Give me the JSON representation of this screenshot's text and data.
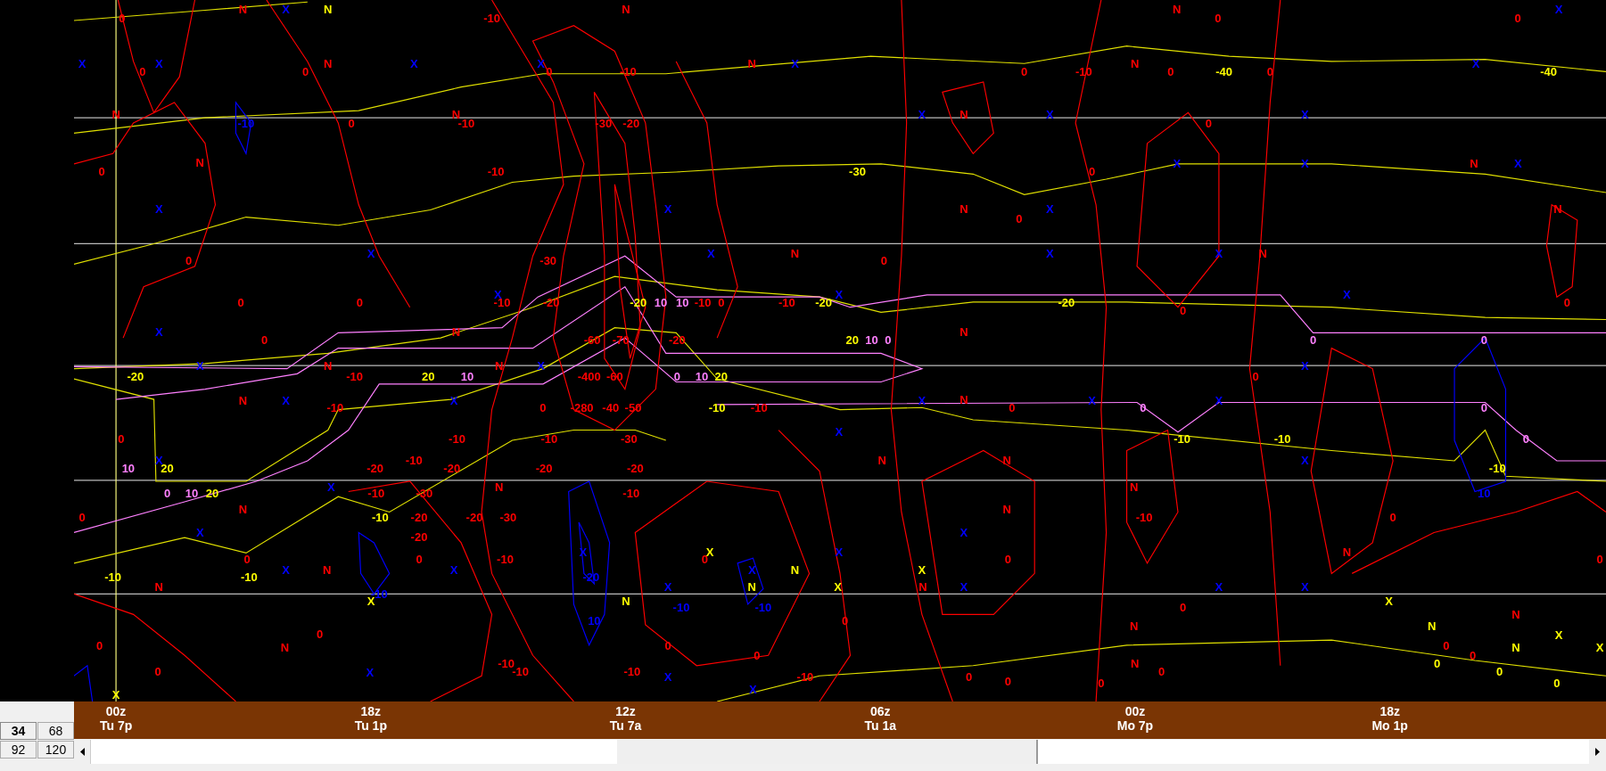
{
  "plot": {
    "labels": [
      {
        "text": "0",
        "color": "#ff0000"
      },
      {
        "text": "N",
        "color": "#ff0000"
      },
      {
        "text": "X",
        "color": "#0000ff"
      },
      {
        "text": "N",
        "color": "#ffff00"
      },
      {
        "text": "-10",
        "color": "#ff0000"
      },
      {
        "text": "N",
        "color": "#ff0000"
      },
      {
        "text": "N",
        "color": "#ff0000"
      },
      {
        "text": "0",
        "color": "#ff0000"
      },
      {
        "text": "0",
        "color": "#ff0000"
      },
      {
        "text": "X",
        "color": "#0000ff"
      },
      {
        "text": "X",
        "color": "#0000ff"
      },
      {
        "text": "0",
        "color": "#ff0000"
      },
      {
        "text": "X",
        "color": "#0000ff"
      },
      {
        "text": "0",
        "color": "#ff0000"
      },
      {
        "text": "N",
        "color": "#ff0000"
      },
      {
        "text": "X",
        "color": "#0000ff"
      },
      {
        "text": "X",
        "color": "#0000ff"
      },
      {
        "text": "0",
        "color": "#ff0000"
      },
      {
        "text": "-10",
        "color": "#ff0000"
      },
      {
        "text": "N",
        "color": "#ff0000"
      },
      {
        "text": "X",
        "color": "#0000ff"
      },
      {
        "text": "0",
        "color": "#ff0000"
      },
      {
        "text": "-10",
        "color": "#ff0000"
      },
      {
        "text": "N",
        "color": "#ff0000"
      },
      {
        "text": "0",
        "color": "#ff0000"
      },
      {
        "text": "-40",
        "color": "#ffff00"
      },
      {
        "text": "0",
        "color": "#ff0000"
      },
      {
        "text": "X",
        "color": "#0000ff"
      },
      {
        "text": "-40",
        "color": "#ffff00"
      },
      {
        "text": "N",
        "color": "#ff0000"
      },
      {
        "text": "-10",
        "color": "#0000ff"
      },
      {
        "text": "0",
        "color": "#ff0000"
      },
      {
        "text": "N",
        "color": "#ff0000"
      },
      {
        "text": "-10",
        "color": "#ff0000"
      },
      {
        "text": "-30",
        "color": "#ff0000"
      },
      {
        "text": "-20",
        "color": "#ff0000"
      },
      {
        "text": "X",
        "color": "#0000ff"
      },
      {
        "text": "N",
        "color": "#ff0000"
      },
      {
        "text": "X",
        "color": "#0000ff"
      },
      {
        "text": "0",
        "color": "#ff0000"
      },
      {
        "text": "X",
        "color": "#0000ff"
      },
      {
        "text": "0",
        "color": "#ff0000"
      },
      {
        "text": "N",
        "color": "#ff0000"
      },
      {
        "text": "-10",
        "color": "#ff0000"
      },
      {
        "text": "-30",
        "color": "#ffff00"
      },
      {
        "text": "0",
        "color": "#ff0000"
      },
      {
        "text": "X",
        "color": "#0000ff"
      },
      {
        "text": "X",
        "color": "#0000ff"
      },
      {
        "text": "N",
        "color": "#ff0000"
      },
      {
        "text": "X",
        "color": "#0000ff"
      },
      {
        "text": "X",
        "color": "#0000ff"
      },
      {
        "text": "X",
        "color": "#0000ff"
      },
      {
        "text": "N",
        "color": "#ff0000"
      },
      {
        "text": "0",
        "color": "#ff0000"
      },
      {
        "text": "X",
        "color": "#0000ff"
      },
      {
        "text": "N",
        "color": "#ff0000"
      },
      {
        "text": "0",
        "color": "#ff0000"
      },
      {
        "text": "X",
        "color": "#0000ff"
      },
      {
        "text": "-30",
        "color": "#ff0000"
      },
      {
        "text": "X",
        "color": "#0000ff"
      },
      {
        "text": "N",
        "color": "#ff0000"
      },
      {
        "text": "0",
        "color": "#ff0000"
      },
      {
        "text": "X",
        "color": "#0000ff"
      },
      {
        "text": "X",
        "color": "#0000ff"
      },
      {
        "text": "N",
        "color": "#ff0000"
      },
      {
        "text": "0",
        "color": "#ff0000"
      },
      {
        "text": "0",
        "color": "#ff0000"
      },
      {
        "text": "X",
        "color": "#0000ff"
      },
      {
        "text": "-10",
        "color": "#ff0000"
      },
      {
        "text": "-20",
        "color": "#ff0000"
      },
      {
        "text": "-20",
        "color": "#ffff00"
      },
      {
        "text": "10",
        "color": "#ff80ff"
      },
      {
        "text": "10",
        "color": "#ff80ff"
      },
      {
        "text": "-10",
        "color": "#ff0000"
      },
      {
        "text": "0",
        "color": "#ff0000"
      },
      {
        "text": "-10",
        "color": "#ff0000"
      },
      {
        "text": "-20",
        "color": "#ffff00"
      },
      {
        "text": "X",
        "color": "#0000ff"
      },
      {
        "text": "-20",
        "color": "#ffff00"
      },
      {
        "text": "0",
        "color": "#ff0000"
      },
      {
        "text": "X",
        "color": "#0000ff"
      },
      {
        "text": "0",
        "color": "#ff0000"
      },
      {
        "text": "X",
        "color": "#0000ff"
      },
      {
        "text": "0",
        "color": "#ff0000"
      },
      {
        "text": "N",
        "color": "#ff0000"
      },
      {
        "text": "-60",
        "color": "#ff0000"
      },
      {
        "text": "-70",
        "color": "#ff0000"
      },
      {
        "text": "-20",
        "color": "#ff0000"
      },
      {
        "text": "20",
        "color": "#ffff00"
      },
      {
        "text": "10",
        "color": "#ff80ff"
      },
      {
        "text": "0",
        "color": "#ff80ff"
      },
      {
        "text": "N",
        "color": "#ff0000"
      },
      {
        "text": "0",
        "color": "#ff80ff"
      },
      {
        "text": "0",
        "color": "#ff80ff"
      },
      {
        "text": "-20",
        "color": "#ffff00"
      },
      {
        "text": "X",
        "color": "#0000ff"
      },
      {
        "text": "N",
        "color": "#ff0000"
      },
      {
        "text": "-10",
        "color": "#ff0000"
      },
      {
        "text": "20",
        "color": "#ffff00"
      },
      {
        "text": "10",
        "color": "#ff80ff"
      },
      {
        "text": "N",
        "color": "#ff0000"
      },
      {
        "text": "X",
        "color": "#0000ff"
      },
      {
        "text": "-400",
        "color": "#ff0000"
      },
      {
        "text": "-60",
        "color": "#ff0000"
      },
      {
        "text": "0",
        "color": "#ff80ff"
      },
      {
        "text": "10",
        "color": "#ff80ff"
      },
      {
        "text": "20",
        "color": "#ffff00"
      },
      {
        "text": "0",
        "color": "#ff0000"
      },
      {
        "text": "X",
        "color": "#0000ff"
      },
      {
        "text": "N",
        "color": "#ff0000"
      },
      {
        "text": "X",
        "color": "#0000ff"
      },
      {
        "text": "-10",
        "color": "#ff0000"
      },
      {
        "text": "X",
        "color": "#0000ff"
      },
      {
        "text": "0",
        "color": "#ff0000"
      },
      {
        "text": "-280",
        "color": "#ff0000"
      },
      {
        "text": "-40",
        "color": "#ff0000"
      },
      {
        "text": "-50",
        "color": "#ff0000"
      },
      {
        "text": "-10",
        "color": "#ffff00"
      },
      {
        "text": "-10",
        "color": "#ff0000"
      },
      {
        "text": "X",
        "color": "#0000ff"
      },
      {
        "text": "N",
        "color": "#ff0000"
      },
      {
        "text": "0",
        "color": "#ff0000"
      },
      {
        "text": "X",
        "color": "#0000ff"
      },
      {
        "text": "0",
        "color": "#ff80ff"
      },
      {
        "text": "X",
        "color": "#0000ff"
      },
      {
        "text": "0",
        "color": "#ff80ff"
      },
      {
        "text": "0",
        "color": "#ff0000"
      },
      {
        "text": "-10",
        "color": "#ff0000"
      },
      {
        "text": "-10",
        "color": "#ff0000"
      },
      {
        "text": "-30",
        "color": "#ff0000"
      },
      {
        "text": "X",
        "color": "#0000ff"
      },
      {
        "text": "-10",
        "color": "#ffff00"
      },
      {
        "text": "-10",
        "color": "#ffff00"
      },
      {
        "text": "0",
        "color": "#ff80ff"
      },
      {
        "text": "10",
        "color": "#ff80ff"
      },
      {
        "text": "X",
        "color": "#0000ff"
      },
      {
        "text": "20",
        "color": "#ffff00"
      },
      {
        "text": "-20",
        "color": "#ff0000"
      },
      {
        "text": "-10",
        "color": "#ff0000"
      },
      {
        "text": "-20",
        "color": "#ff0000"
      },
      {
        "text": "-20",
        "color": "#ff0000"
      },
      {
        "text": "-20",
        "color": "#ff0000"
      },
      {
        "text": "N",
        "color": "#ff0000"
      },
      {
        "text": "N",
        "color": "#ff0000"
      },
      {
        "text": "X",
        "color": "#0000ff"
      },
      {
        "text": "-10",
        "color": "#ffff00"
      },
      {
        "text": "0",
        "color": "#ff80ff"
      },
      {
        "text": "10",
        "color": "#ff80ff"
      },
      {
        "text": "20",
        "color": "#ffff00"
      },
      {
        "text": "X",
        "color": "#0000ff"
      },
      {
        "text": "-10",
        "color": "#ff0000"
      },
      {
        "text": "-30",
        "color": "#ff0000"
      },
      {
        "text": "N",
        "color": "#ff0000"
      },
      {
        "text": "-10",
        "color": "#ff0000"
      },
      {
        "text": "N",
        "color": "#ff0000"
      },
      {
        "text": "10",
        "color": "#0000ff"
      },
      {
        "text": "0",
        "color": "#ff0000"
      },
      {
        "text": "N",
        "color": "#ff0000"
      },
      {
        "text": "-10",
        "color": "#ffff00"
      },
      {
        "text": "-20",
        "color": "#ff0000"
      },
      {
        "text": "-20",
        "color": "#ff0000"
      },
      {
        "text": "-30",
        "color": "#ff0000"
      },
      {
        "text": "N",
        "color": "#ff0000"
      },
      {
        "text": "-10",
        "color": "#ff0000"
      },
      {
        "text": "0",
        "color": "#ff0000"
      },
      {
        "text": "X",
        "color": "#0000ff"
      },
      {
        "text": "-20",
        "color": "#ff0000"
      },
      {
        "text": "X",
        "color": "#0000ff"
      },
      {
        "text": "0",
        "color": "#ff0000"
      },
      {
        "text": "0",
        "color": "#ff0000"
      },
      {
        "text": "-10",
        "color": "#ff0000"
      },
      {
        "text": "X",
        "color": "#0000ff"
      },
      {
        "text": "0",
        "color": "#ff0000"
      },
      {
        "text": "X",
        "color": "#ffff00"
      },
      {
        "text": "X",
        "color": "#0000ff"
      },
      {
        "text": "0",
        "color": "#ff0000"
      },
      {
        "text": "N",
        "color": "#ff0000"
      },
      {
        "text": "0",
        "color": "#ff0000"
      },
      {
        "text": "-10",
        "color": "#ffff00"
      },
      {
        "text": "-10",
        "color": "#ffff00"
      },
      {
        "text": "X",
        "color": "#0000ff"
      },
      {
        "text": "N",
        "color": "#ff0000"
      },
      {
        "text": "X",
        "color": "#0000ff"
      },
      {
        "text": "-20",
        "color": "#0000ff"
      },
      {
        "text": "X",
        "color": "#0000ff"
      },
      {
        "text": "N",
        "color": "#ffff00"
      },
      {
        "text": "X",
        "color": "#ffff00"
      },
      {
        "text": "N",
        "color": "#ff0000"
      },
      {
        "text": "-10",
        "color": "#0000ff"
      },
      {
        "text": "X",
        "color": "#0000ff"
      },
      {
        "text": "N",
        "color": "#ffff00"
      },
      {
        "text": "X",
        "color": "#ffff00"
      },
      {
        "text": "N",
        "color": "#ff0000"
      },
      {
        "text": "X",
        "color": "#0000ff"
      },
      {
        "text": "X",
        "color": "#0000ff"
      },
      {
        "text": "X",
        "color": "#0000ff"
      },
      {
        "text": "X",
        "color": "#ffff00"
      },
      {
        "text": "N",
        "color": "#ffff00"
      },
      {
        "text": "-10",
        "color": "#0000ff"
      },
      {
        "text": "-10",
        "color": "#0000ff"
      },
      {
        "text": "0",
        "color": "#ff0000"
      },
      {
        "text": "X",
        "color": "#ffff00"
      },
      {
        "text": "10",
        "color": "#0000ff"
      },
      {
        "text": "0",
        "color": "#ff0000"
      },
      {
        "text": "N",
        "color": "#ff0000"
      },
      {
        "text": "N",
        "color": "#ffff00"
      },
      {
        "text": "N",
        "color": "#ff0000"
      },
      {
        "text": "0",
        "color": "#ff0000"
      },
      {
        "text": "N",
        "color": "#ff0000"
      },
      {
        "text": "0",
        "color": "#ff0000"
      },
      {
        "text": "0",
        "color": "#ff0000"
      },
      {
        "text": "0",
        "color": "#ff0000"
      },
      {
        "text": "N",
        "color": "#ffff00"
      },
      {
        "text": "X",
        "color": "#ffff00"
      },
      {
        "text": "X",
        "color": "#ffff00"
      },
      {
        "text": "-10",
        "color": "#ff0000"
      },
      {
        "text": "0",
        "color": "#ff0000"
      },
      {
        "text": "N",
        "color": "#ff0000"
      },
      {
        "text": "0",
        "color": "#ffff00"
      },
      {
        "text": "0",
        "color": "#ff0000"
      },
      {
        "text": "0",
        "color": "#ff0000"
      },
      {
        "text": "X",
        "color": "#0000ff"
      },
      {
        "text": "-10",
        "color": "#ff0000"
      },
      {
        "text": "-10",
        "color": "#ff0000"
      },
      {
        "text": "X",
        "color": "#0000ff"
      },
      {
        "text": "-10",
        "color": "#ff0000"
      },
      {
        "text": "0",
        "color": "#ff0000"
      },
      {
        "text": "0",
        "color": "#ff0000"
      },
      {
        "text": "0",
        "color": "#ff0000"
      },
      {
        "text": "0",
        "color": "#ff0000"
      },
      {
        "text": "0",
        "color": "#ffff00"
      },
      {
        "text": "0",
        "color": "#ffff00"
      },
      {
        "text": "X",
        "color": "#ffff00"
      },
      {
        "text": "X",
        "color": "#0000ff"
      }
    ]
  },
  "time_axis": [
    {
      "time": "00z",
      "local": "Tu 7p"
    },
    {
      "time": "18z",
      "local": "Tu 1p"
    },
    {
      "time": "12z",
      "local": "Tu 7a"
    },
    {
      "time": "06z",
      "local": "Tu 1a"
    },
    {
      "time": "00z",
      "local": "Mo 7p"
    },
    {
      "time": "18z",
      "local": "Mo 1p"
    }
  ],
  "range_buttons": [
    {
      "label": "34",
      "selected": true
    },
    {
      "label": "68",
      "selected": false
    },
    {
      "label": "92",
      "selected": false
    },
    {
      "label": "120",
      "selected": false
    }
  ]
}
